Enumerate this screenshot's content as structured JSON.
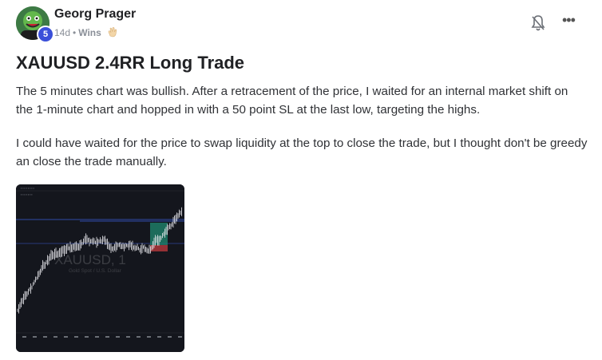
{
  "post": {
    "author": "Georg Prager",
    "level": "5",
    "time": "14d",
    "separator": "•",
    "wins_label": "Wins",
    "title": "XAUUSD 2.4RR Long Trade",
    "paragraphs": [
      "The 5 minutes chart was bullish. After a retracement of the price, I waited for an internal market shift on the 1-minute chart and hopped in with a 50 point SL at the last low, targeting the highs.",
      "I could have waited for the price to swap liquidity at the top to close the trade, but I thought don't be greedy an close the trade manually."
    ],
    "more_icon": "•••"
  },
  "icons": {
    "avatar": "avatar-image",
    "clap": "clapping-hands-icon",
    "bell": "bell-muted-icon",
    "more": "more-options-icon"
  },
  "chart_image": {
    "watermark_symbol": "XAUUSD, 1",
    "watermark_name": "Gold Spot / U.S. Dollar",
    "colors": {
      "background": "#14161d",
      "candles": "#e6e8ec",
      "tp_zone": "#1f8a70",
      "sl_zone": "#c0393d",
      "level_line": "#3b5bd6"
    }
  },
  "colors": {
    "badge": "#3a4fd9",
    "text": "#202124",
    "muted": "#8a8f98"
  }
}
